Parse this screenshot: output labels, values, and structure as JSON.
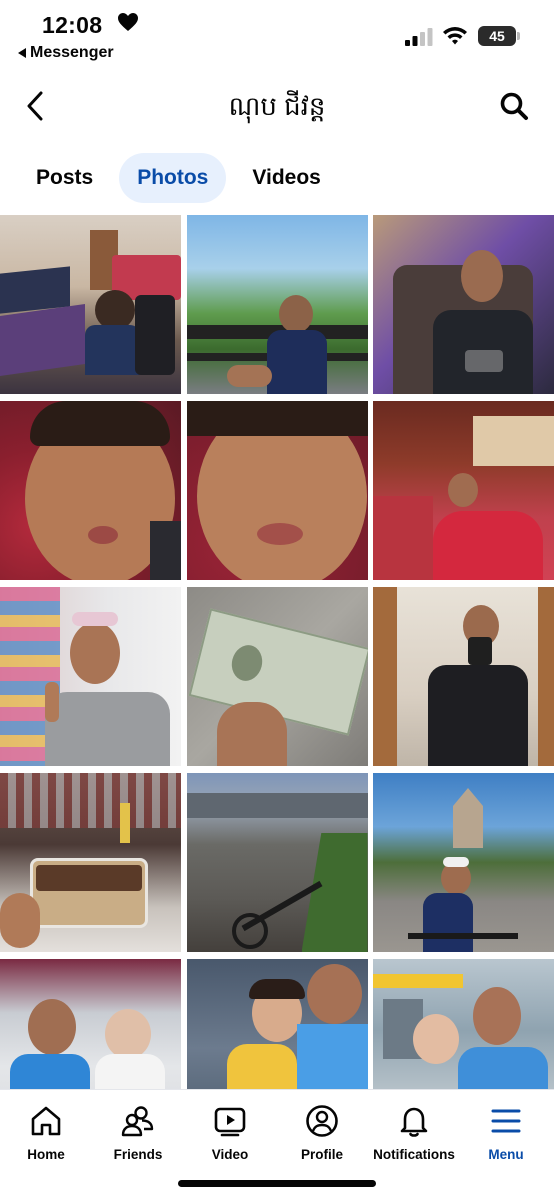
{
  "status_bar": {
    "time": "12:08",
    "back_app": "Messenger",
    "battery": "45"
  },
  "header": {
    "title": "ណុប ជីវន្ត"
  },
  "tabs": [
    {
      "label": "Posts",
      "active": false
    },
    {
      "label": "Photos",
      "active": true
    },
    {
      "label": "Videos",
      "active": false
    }
  ],
  "photos": [
    {
      "name": "photo-gaming-setup"
    },
    {
      "name": "photo-balcony-selfie"
    },
    {
      "name": "photo-armchair-portrait"
    },
    {
      "name": "photo-pout-closeup-1"
    },
    {
      "name": "photo-pout-closeup-2"
    },
    {
      "name": "photo-lying-on-bed"
    },
    {
      "name": "photo-shop-peace-sign"
    },
    {
      "name": "photo-dollar-bill"
    },
    {
      "name": "photo-mirror-selfie"
    },
    {
      "name": "photo-tiramisu-box"
    },
    {
      "name": "photo-bike-road"
    },
    {
      "name": "photo-temple-gate-selfie"
    },
    {
      "name": "photo-with-baby-1"
    },
    {
      "name": "photo-with-girl"
    },
    {
      "name": "photo-with-baby-airport"
    }
  ],
  "bottom_nav": [
    {
      "label": "Home",
      "icon": "home-icon",
      "active": false
    },
    {
      "label": "Friends",
      "icon": "friends-icon",
      "active": false
    },
    {
      "label": "Video",
      "icon": "video-icon",
      "active": false
    },
    {
      "label": "Profile",
      "icon": "profile-icon",
      "active": false
    },
    {
      "label": "Notifications",
      "icon": "bell-icon",
      "active": false
    },
    {
      "label": "Menu",
      "icon": "menu-icon",
      "active": true
    }
  ],
  "colors": {
    "accent": "#0a4ca8",
    "active_tab_bg": "#e7f0fd"
  }
}
